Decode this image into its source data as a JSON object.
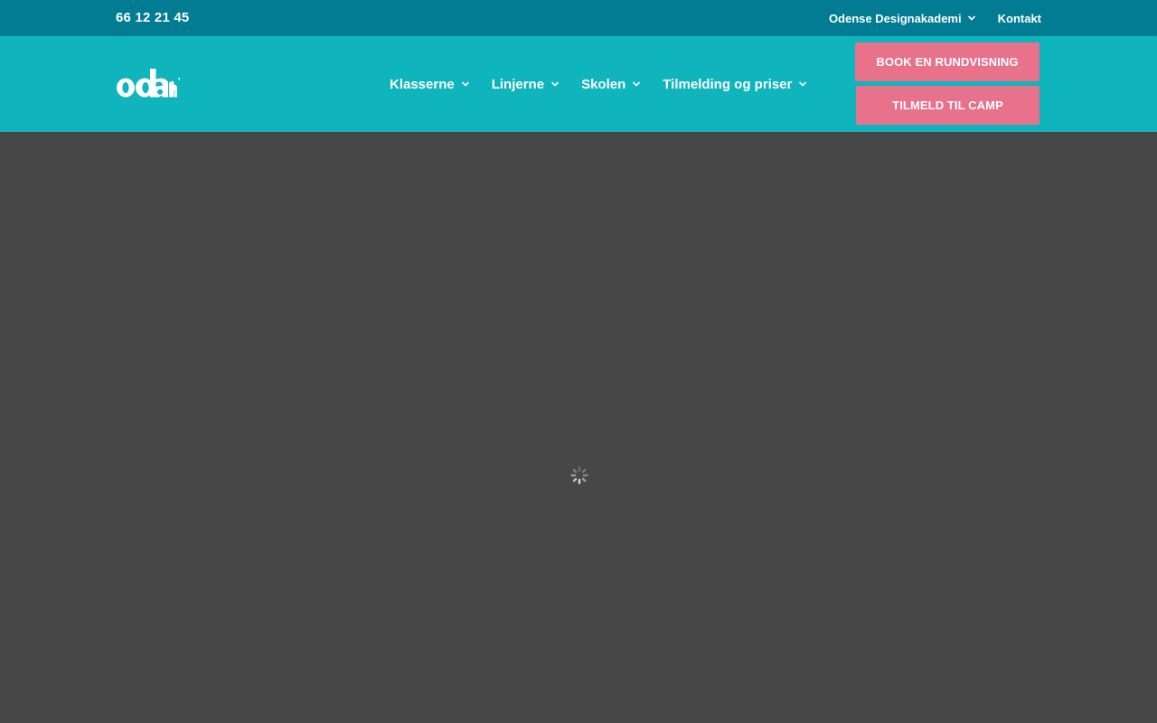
{
  "topbar": {
    "phone": "66 12 21 45",
    "links": [
      {
        "label": "Odense Designakademi",
        "has_dropdown": true
      },
      {
        "label": "Kontakt",
        "has_dropdown": false
      }
    ]
  },
  "header": {
    "logo_text": "oda",
    "nav": [
      {
        "label": "Klasserne"
      },
      {
        "label": "Linjerne"
      },
      {
        "label": "Skolen"
      },
      {
        "label": "Tilmelding og priser"
      }
    ],
    "cta_primary": "BOOK EN RUNDVISNING",
    "cta_secondary": "TILMELD TIL CAMP"
  },
  "content": {
    "state": "loading",
    "spinner_icon": "loading-spinner-icon"
  },
  "colors": {
    "topbar_bg": "#017c93",
    "header_bg": "#0fb4bc",
    "cta_bg": "#e8718c",
    "content_bg": "#474747"
  }
}
